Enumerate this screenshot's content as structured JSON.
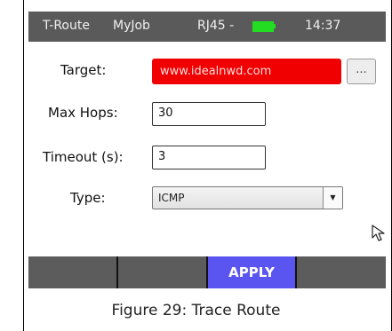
{
  "status_bar": {
    "title": "T-Route",
    "job": "MyJob",
    "port": "RJ45 -",
    "time": "14:37",
    "battery_color": "#22dd22"
  },
  "form": {
    "target": {
      "label": "Target:",
      "value": "www.idealnwd.com",
      "more_label": "..."
    },
    "max_hops": {
      "label": "Max Hops:",
      "value": "30"
    },
    "timeout": {
      "label": "Timeout (s):",
      "value": "3"
    },
    "type": {
      "label": "Type:",
      "value": "ICMP"
    }
  },
  "softkeys": [
    "",
    "",
    "APPLY",
    ""
  ],
  "colors": {
    "target_bg": "#f00000",
    "apply_bg": "#5a55f0",
    "bar_bg": "#5c5c5c"
  },
  "caption": "Figure 29: Trace Route"
}
